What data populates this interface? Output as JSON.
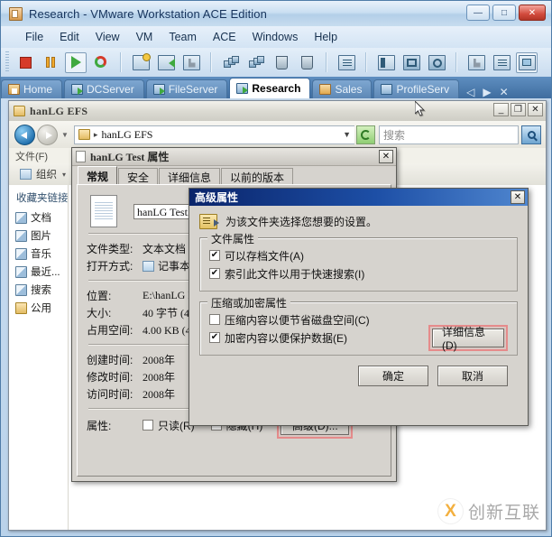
{
  "vmware": {
    "title": "Research - VMware Workstation ACE Edition",
    "window_buttons": [
      {
        "name": "minimize",
        "glyph": "—"
      },
      {
        "name": "maximize",
        "glyph": "□"
      },
      {
        "name": "close",
        "glyph": "✕"
      }
    ],
    "menu": [
      "File",
      "Edit",
      "View",
      "VM",
      "Team",
      "ACE",
      "Windows",
      "Help"
    ],
    "toolbar_icons": [
      "stop-icon",
      "pause-icon",
      "play-icon",
      "reset-icon",
      "take-snapshot-icon",
      "revert-snapshot-icon",
      "manage-snapshots-icon",
      "clone-icon",
      "multiple-vm-icon",
      "delete-vm-icon",
      "trash-icon",
      "summary-icon",
      "show-sidebar-icon",
      "fullscreen-icon",
      "quick-switch-icon",
      "settings-wrench-icon",
      "summary-view-icon",
      "console-view-icon"
    ],
    "tabs": [
      {
        "label": "Home",
        "icon": "home-icon",
        "active": false
      },
      {
        "label": "DCServer",
        "icon": "vm-powered-icon",
        "active": false
      },
      {
        "label": "FileServer",
        "icon": "vm-powered-icon",
        "active": false
      },
      {
        "label": "Research",
        "icon": "vm-powered-icon",
        "active": true
      },
      {
        "label": "Sales",
        "icon": "vm-suspended-icon",
        "active": false
      },
      {
        "label": "ProfileServ",
        "icon": "vm-stopped-icon",
        "active": false
      }
    ],
    "tab_nav": [
      "◁",
      "▶",
      "✕"
    ]
  },
  "explorer": {
    "title": "hanLG EFS",
    "window_buttons": [
      {
        "name": "minimize",
        "glyph": "_"
      },
      {
        "name": "restore",
        "glyph": "❐"
      },
      {
        "name": "close",
        "glyph": "✕"
      }
    ],
    "back_icon": "back-arrow-icon",
    "forward_icon": "forward-arrow-icon",
    "history_caret": "▼",
    "path": "hanLG EFS",
    "path_sep": "▸",
    "path_caret": "▼",
    "refresh_icon": "refresh-icon",
    "search_placeholder": "搜索",
    "search_button_icon": "search-icon",
    "menu": [
      "文件(F)"
    ],
    "organize_label": "组织",
    "organize_caret": "▾",
    "favorites_header": "收藏夹链接",
    "sidebar_items": [
      {
        "label": "文档",
        "icon": "documents-icon"
      },
      {
        "label": "图片",
        "icon": "pictures-icon"
      },
      {
        "label": "音乐",
        "icon": "music-icon"
      },
      {
        "label": "最近...",
        "icon": "recent-icon"
      },
      {
        "label": "搜索",
        "icon": "search-folder-icon"
      },
      {
        "label": "公用",
        "icon": "public-folder-icon"
      }
    ]
  },
  "watermark": {
    "logo": "X",
    "text": "创新互联"
  },
  "properties_dialog": {
    "title": "hanLG Test 属性",
    "close_glyph": "✕",
    "file_icon": "text-file-icon",
    "tabs": [
      {
        "label": "常规",
        "active": true
      },
      {
        "label": "安全",
        "active": false
      },
      {
        "label": "详细信息",
        "active": false
      },
      {
        "label": "以前的版本",
        "active": false
      }
    ],
    "filename": "hanLG Test.txt",
    "fields": [
      {
        "key": "文件类型:",
        "value": "文本文档 (.txt)"
      },
      {
        "key": "打开方式:",
        "value": "记事本",
        "icon": "notepad-icon"
      },
      {
        "key": "位置:",
        "value": "E:\\hanLG EFS"
      },
      {
        "key": "大小:",
        "value": "40 字节 (40 字节)"
      },
      {
        "key": "占用空间:",
        "value": "4.00 KB (4,096 字节)"
      },
      {
        "key": "创建时间:",
        "value": "2008年"
      },
      {
        "key": "修改时间:",
        "value": "2008年"
      },
      {
        "key": "访问时间:",
        "value": "2008年"
      }
    ],
    "attributes_label": "属性:",
    "readonly": {
      "label": "只读(R)",
      "checked": false
    },
    "hidden": {
      "label": "隐藏(H)",
      "checked": false
    },
    "advanced_button": "高级(D)..."
  },
  "advanced_dialog": {
    "title": "高级属性",
    "close_glyph": "✕",
    "header_icon": "folder-settings-icon",
    "header_text": "为该文件夹选择您想要的设置。",
    "file_attributes": {
      "legend": "文件属性",
      "items": [
        {
          "label": "可以存档文件(A)",
          "checked": true
        },
        {
          "label": "索引此文件以用于快速搜索(I)",
          "checked": true
        }
      ]
    },
    "compress_encrypt": {
      "legend": "压缩或加密属性",
      "items": [
        {
          "label": "压缩内容以便节省磁盘空间(C)",
          "checked": false
        },
        {
          "label": "加密内容以便保护数据(E)",
          "checked": true
        }
      ],
      "details_button": "详细信息(D)"
    },
    "ok_button": "确定",
    "cancel_button": "取消"
  },
  "colors": {
    "highlight_red": "#e58b8b",
    "title_blue": "#1d4fa6",
    "vm_title_text": "#16335c",
    "watermark_orange": "#f1a31e"
  }
}
